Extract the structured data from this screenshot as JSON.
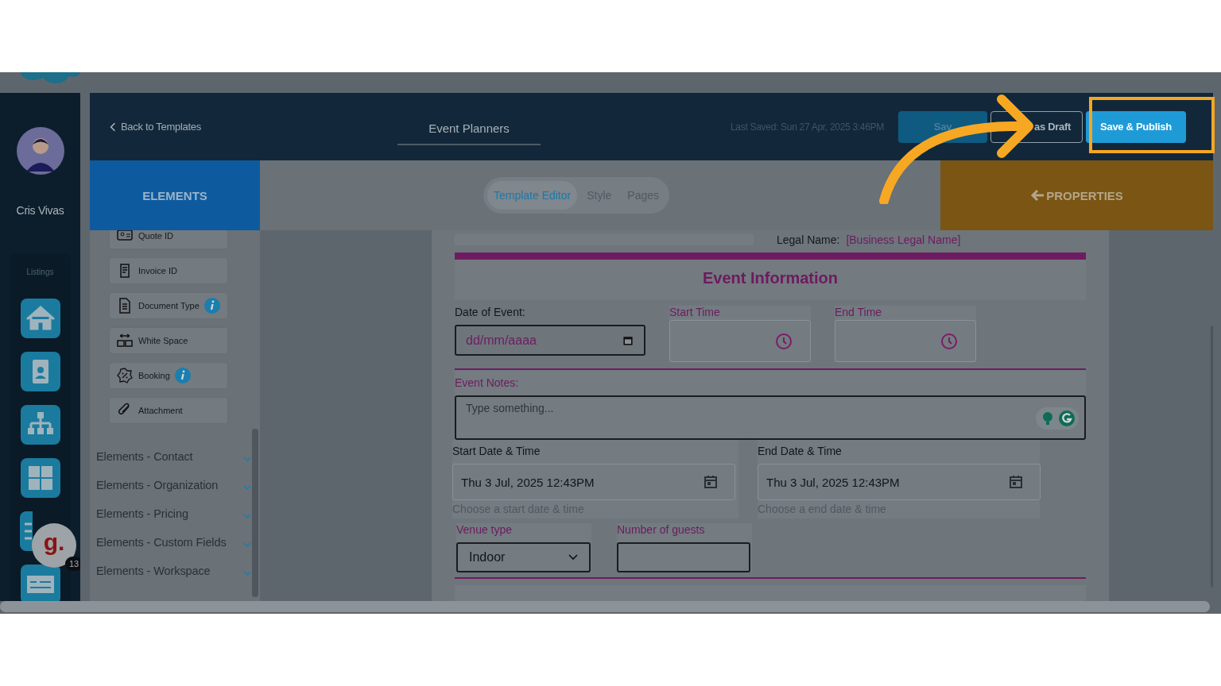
{
  "sidebar": {
    "user_name": "Cris Vivas",
    "section_label": "Listings",
    "chat_badge": {
      "logo": "g.",
      "count": "13"
    }
  },
  "header": {
    "back_link": "Back to Templates",
    "title": "Event Planners",
    "last_saved": "Last Saved: Sun 27 Apr, 2025 3:46PM",
    "buttons": [
      {
        "label": "Sav",
        "kind": "solid",
        "highlighted": false
      },
      {
        "label": "as Draft",
        "kind": "outline",
        "highlighted": false
      },
      {
        "label": "Save & Publish",
        "kind": "solid",
        "highlighted": true
      }
    ]
  },
  "elements_panel": {
    "title": "ELEMENTS",
    "items": [
      {
        "label": "Quote ID",
        "info": false
      },
      {
        "label": "Invoice ID",
        "info": false
      },
      {
        "label": "Document Type",
        "info": true
      },
      {
        "label": "White Space",
        "info": false
      },
      {
        "label": "Booking",
        "info": true
      },
      {
        "label": "Attachment",
        "info": false
      }
    ],
    "sections": [
      {
        "label": "Elements - Contact",
        "expanded": false
      },
      {
        "label": "Elements - Organization",
        "expanded": false
      },
      {
        "label": "Elements - Pricing",
        "expanded": false
      },
      {
        "label": "Elements - Custom Fields",
        "expanded": false
      },
      {
        "label": "Elements - Workspace",
        "expanded": false
      }
    ]
  },
  "editor_tabs": [
    {
      "label": "Template Editor",
      "selected": true
    },
    {
      "label": "Style",
      "selected": false
    },
    {
      "label": "Pages",
      "selected": false
    }
  ],
  "properties_panel": {
    "title": "PROPERTIES"
  },
  "document": {
    "legal_name_label": "Legal Name:",
    "legal_name_value": "[Business Legal Name]",
    "section_title": "Event Information",
    "date_of_event": {
      "label": "Date of Event:",
      "placeholder": "dd/mm/aaaa"
    },
    "start_time": {
      "label": "Start Time"
    },
    "end_time": {
      "label": "End Time"
    },
    "event_notes": {
      "label": "Event Notes:",
      "placeholder": "Type something..."
    },
    "start_datetime": {
      "label": "Start Date & Time",
      "value": "Thu 3 Jul, 2025 12:43PM",
      "hint": "Choose a start date & time"
    },
    "end_datetime": {
      "label": "End Date & Time",
      "value": "Thu 3 Jul, 2025 12:43PM",
      "hint": "Choose a end date & time"
    },
    "venue_type": {
      "label": "Venue type",
      "value": "Indoor"
    },
    "guests": {
      "label": "Number of guests"
    }
  }
}
